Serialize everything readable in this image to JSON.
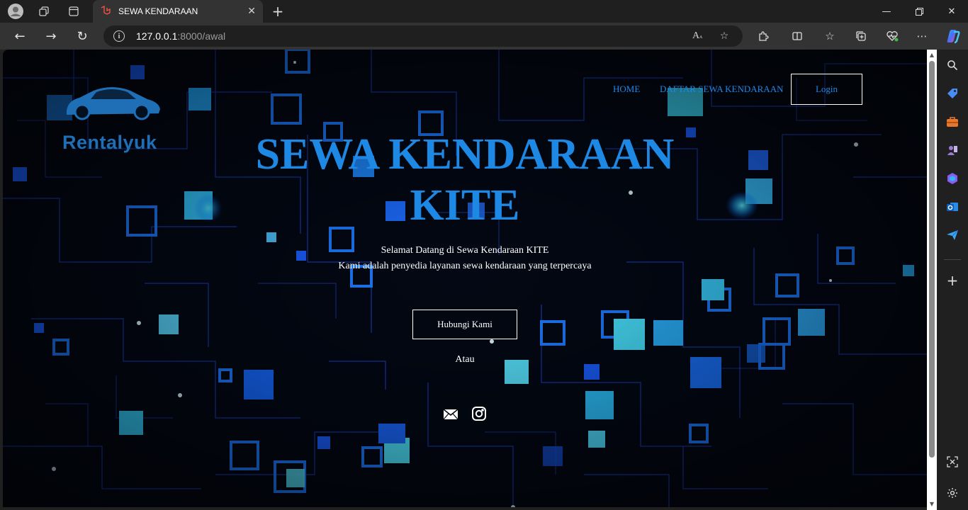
{
  "browser": {
    "tab_title": "SEWA KENDARAAN",
    "url_host": "127.0.0.1",
    "url_rest": ":8000/awal",
    "accent_color": "#1e88e5"
  },
  "site": {
    "logo_text": "Rentalyuk",
    "nav": {
      "home": "HOME",
      "daftar": "DAFTAR SEWA KENDARAAN",
      "login": "Login"
    },
    "hero": {
      "title_line1": "SEWA KENDARAAN",
      "title_line2": "KITE",
      "welcome": "Selamat Datang di Sewa Kendaraan KITE",
      "tagline": "Kami adalah penyedia layanan sewa kendaraan yang terpercaya"
    },
    "contact_button": "Hubungi Kami",
    "or_text": "Atau",
    "social_icons": [
      "mail-icon",
      "instagram-icon"
    ]
  }
}
